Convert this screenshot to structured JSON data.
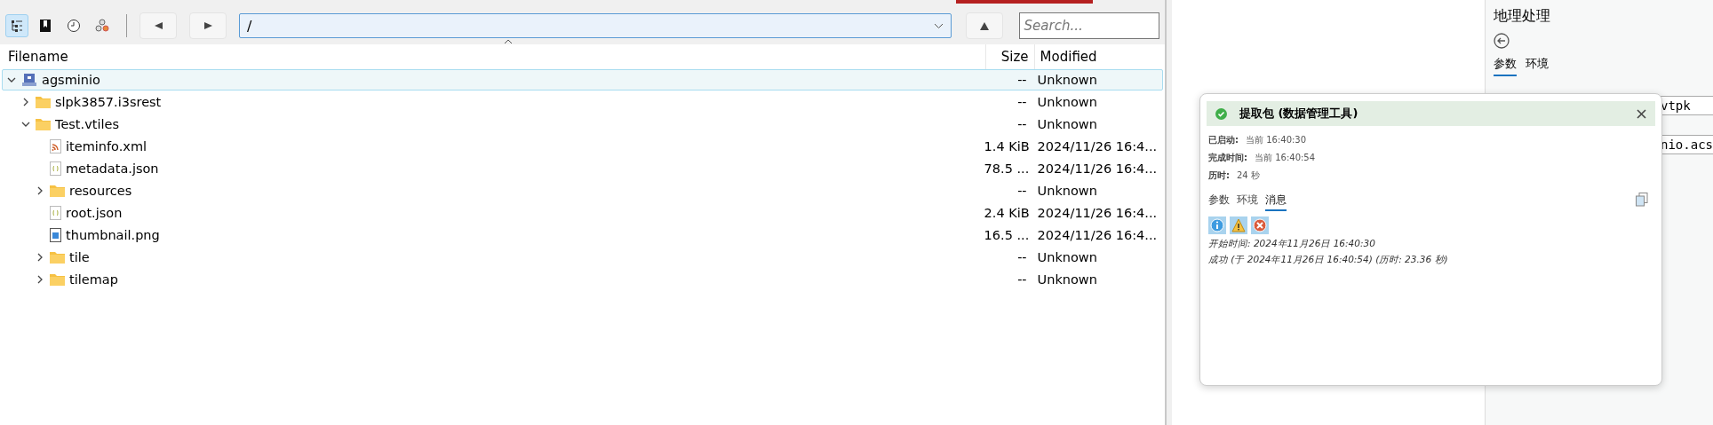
{
  "toolbar": {
    "toggles": [
      {
        "kind": "tree",
        "selected": true
      },
      {
        "kind": "bookmarks",
        "selected": false
      },
      {
        "kind": "history",
        "selected": false
      },
      {
        "kind": "network",
        "selected": false
      }
    ],
    "path": {
      "value": "/"
    },
    "search": {
      "placeholder": "Search..."
    }
  },
  "table": {
    "columns": [
      "Filename",
      "Size",
      "Modified"
    ],
    "rows": [
      {
        "name": "agsminio",
        "kind": "bucket",
        "expanded": true,
        "selected": true,
        "size": "--",
        "modified": "Unknown",
        "children": [
          {
            "name": "slpk3857.i3srest",
            "kind": "folder",
            "expanded": false,
            "selected": false,
            "size": "--",
            "modified": "Unknown"
          },
          {
            "name": "Test.vtiles",
            "kind": "folder",
            "expanded": true,
            "selected": false,
            "size": "--",
            "modified": "Unknown",
            "children": [
              {
                "name": "iteminfo.xml",
                "kind": "xml",
                "selected": false,
                "size": "1.4 KiB",
                "modified": "2024/11/26 16:4..."
              },
              {
                "name": "metadata.json",
                "kind": "json",
                "selected": false,
                "size": "78.5 ...",
                "modified": "2024/11/26 16:4..."
              },
              {
                "name": "resources",
                "kind": "folder",
                "expanded": false,
                "selected": false,
                "size": "--",
                "modified": "Unknown"
              },
              {
                "name": "root.json",
                "kind": "json",
                "selected": false,
                "size": "2.4 KiB",
                "modified": "2024/11/26 16:4..."
              },
              {
                "name": "thumbnail.png",
                "kind": "image",
                "selected": false,
                "size": "16.5 ...",
                "modified": "2024/11/26 16:4..."
              },
              {
                "name": "tile",
                "kind": "folder",
                "expanded": false,
                "selected": false,
                "size": "--",
                "modified": "Unknown"
              },
              {
                "name": "tilemap",
                "kind": "folder",
                "expanded": false,
                "selected": false,
                "size": "--",
                "modified": "Unknown"
              }
            ]
          }
        ]
      }
    ]
  },
  "geoprocessing": {
    "title": "地理处理",
    "tabs": [
      {
        "label": "参数",
        "selected": true
      },
      {
        "label": "环境",
        "selected": false
      }
    ],
    "fields": [
      "vtpk",
      "nio.acs"
    ]
  },
  "dialog": {
    "title": "提取包 (数据管理工具)",
    "info": [
      {
        "label": "已启动:",
        "value": "当前 16:40:30"
      },
      {
        "label": "完成时间:",
        "value": "当前 16:40:54"
      },
      {
        "label": "历时:",
        "value": "24 秒"
      }
    ],
    "tabs": [
      {
        "label": "参数",
        "selected": false
      },
      {
        "label": "环境",
        "selected": false
      },
      {
        "label": "消息",
        "selected": true
      }
    ],
    "filters": [
      {
        "kind": "info"
      },
      {
        "kind": "warning"
      },
      {
        "kind": "error"
      }
    ],
    "messages": [
      "开始时间: 2024年11月26日 16:40:30",
      "成功 (于 2024年11月26日 16:40:54) (历时: 23.36 秒)"
    ]
  }
}
